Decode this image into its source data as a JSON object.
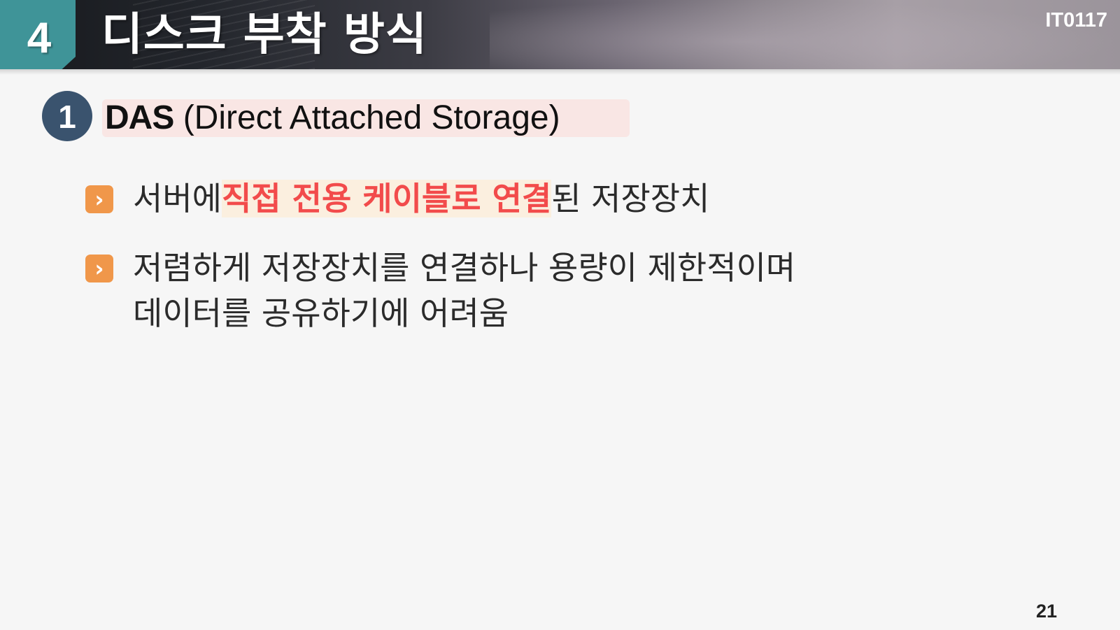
{
  "header": {
    "section_number": "4",
    "title": "디스크 부착 방식",
    "course_code": "IT0117"
  },
  "subsection": {
    "number": "1",
    "abbr": "DAS",
    "full": "(Direct Attached Storage)"
  },
  "bullets": [
    {
      "before": "서버에",
      "highlight": "직접 전용 케이블로 연결",
      "after": "된 저장장치"
    },
    {
      "line1": "저렴하게 저장장치를 연결하나 용량이 제한적이며",
      "line2": "데이터를 공유하기에 어려움"
    }
  ],
  "page_number": "21",
  "colors": {
    "section_tab": "#3f9498",
    "subsection_circle": "#3a536e",
    "bullet_icon": "#f0974a",
    "highlight_text": "#f24b4b"
  },
  "icons": {
    "bullet": "chevron-right-icon"
  }
}
